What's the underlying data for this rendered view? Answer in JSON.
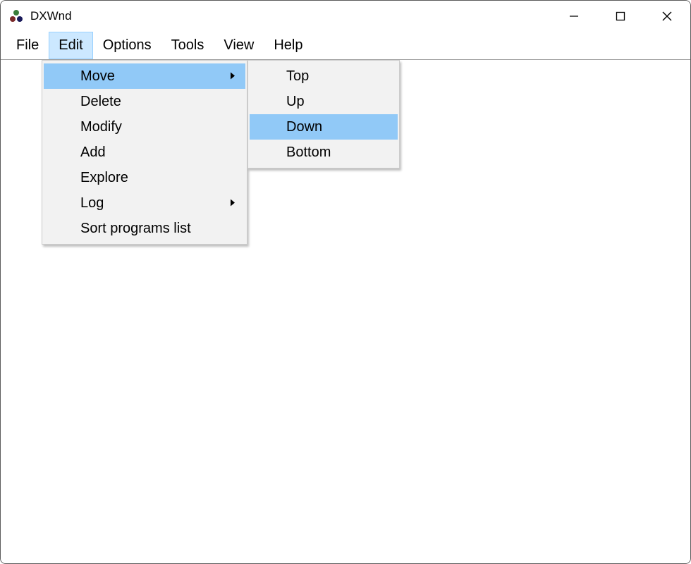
{
  "titlebar": {
    "title": "DXWnd"
  },
  "menubar": {
    "items": [
      {
        "label": "File"
      },
      {
        "label": "Edit"
      },
      {
        "label": "Options"
      },
      {
        "label": "Tools"
      },
      {
        "label": "View"
      },
      {
        "label": "Help"
      }
    ]
  },
  "edit_menu": {
    "items": [
      {
        "label": "Move",
        "has_submenu": true,
        "highlighted": true
      },
      {
        "label": "Delete"
      },
      {
        "label": "Modify"
      },
      {
        "label": "Add"
      },
      {
        "label": "Explore"
      },
      {
        "label": "Log",
        "has_submenu": true
      },
      {
        "label": "Sort programs list"
      }
    ]
  },
  "move_submenu": {
    "items": [
      {
        "label": "Top"
      },
      {
        "label": "Up"
      },
      {
        "label": "Down",
        "highlighted": true
      },
      {
        "label": "Bottom"
      }
    ]
  }
}
